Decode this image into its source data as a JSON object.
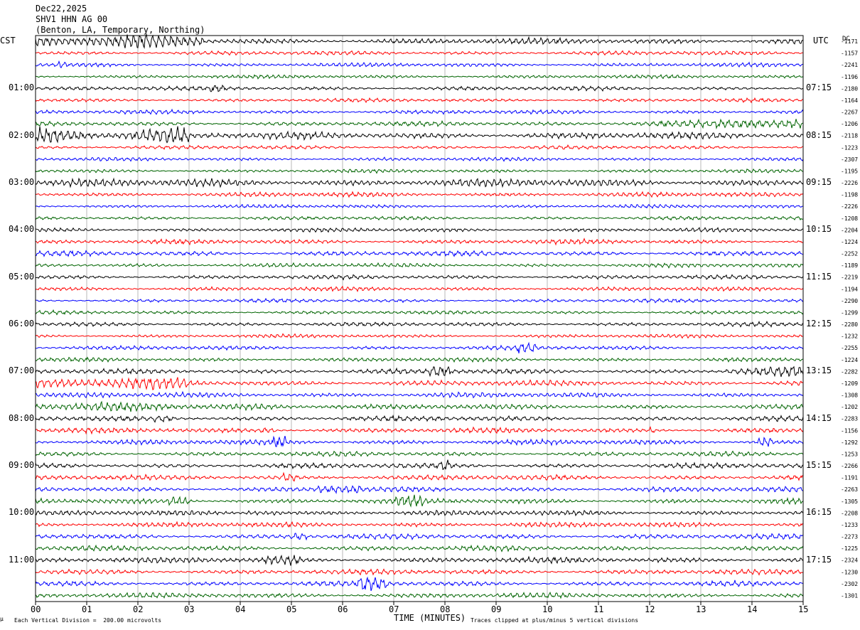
{
  "header": {
    "date": "Dec22,2025",
    "channel": "SHV1 HHN AG 00",
    "location": "(Benton, LA, Temporary, Northing)"
  },
  "left_zone": "CST",
  "right_zone": "UTC",
  "dc_label": "DC",
  "footer": {
    "division": "Each Vertical Division =  200.00 microvolts",
    "xlabel": "TIME (MINUTES)",
    "clip_note": "Traces clipped at plus/minus 5 vertical divisions",
    "corner_mark": "µ"
  },
  "colors": {
    "trace_cycle": [
      "#000000",
      "#ff0000",
      "#0000ff",
      "#006400"
    ],
    "grid": "#888888",
    "frame": "#000000"
  },
  "chart_data": {
    "type": "line",
    "title": "SHV1 HHN AG 00",
    "xlabel": "TIME (MINUTES)",
    "ylabel": "",
    "xlim": [
      0,
      15
    ],
    "x_ticks": [
      "00",
      "01",
      "02",
      "03",
      "04",
      "05",
      "06",
      "07",
      "08",
      "09",
      "10",
      "11",
      "12",
      "13",
      "14",
      "15"
    ],
    "rows_per_hour": 4,
    "left_hour_labels": [
      "01:00",
      "02:00",
      "03:00",
      "04:00",
      "05:00",
      "06:00",
      "07:00",
      "08:00",
      "09:00",
      "10:00",
      "11:00"
    ],
    "right_hour_labels": [
      "07:15",
      "08:15",
      "09:15",
      "10:15",
      "11:15",
      "12:15",
      "13:15",
      "14:15",
      "15:15",
      "16:15",
      "17:15"
    ],
    "dc_offsets": [
      "-1171",
      "-1157",
      "-2241",
      "-1196",
      "-2180",
      "-1164",
      "-2267",
      "-1206",
      "-2118",
      "-1223",
      "-2307",
      "-1195",
      "-2226",
      "-1198",
      "-2226",
      "-1208",
      "-2204",
      "-1224",
      "-2252",
      "-1189",
      "-2219",
      "-1194",
      "-2290",
      "-1299",
      "-2280",
      "-1232",
      "-2255",
      "-1224",
      "-2282",
      "-1209",
      "-1308",
      "-1202",
      "-2283",
      "-1156",
      "-1292",
      "-1253",
      "-2266",
      "-1191",
      "-2263",
      "-1305",
      "-2208",
      "-1233",
      "-2273",
      "-1225",
      "-2324",
      "-1230",
      "-2302",
      "-1301"
    ],
    "series": [
      {
        "trace_color": "black",
        "rows": [
          0,
          4,
          8,
          12,
          16,
          20,
          24,
          28,
          32,
          36,
          40,
          44
        ]
      },
      {
        "trace_color": "red",
        "rows": [
          1,
          5,
          9,
          13,
          17,
          21,
          25,
          29,
          33,
          37,
          41,
          45
        ]
      },
      {
        "trace_color": "blue",
        "rows": [
          2,
          6,
          10,
          14,
          18,
          22,
          26,
          30,
          34,
          38,
          42,
          46
        ]
      },
      {
        "trace_color": "green",
        "rows": [
          3,
          7,
          11,
          15,
          19,
          23,
          27,
          31,
          35,
          39,
          43,
          47
        ]
      }
    ],
    "amplitude": [
      1.2,
      0.8,
      0.8,
      0.7,
      0.8,
      0.7,
      0.8,
      0.9,
      1.3,
      0.7,
      0.7,
      0.7,
      1.0,
      0.9,
      0.7,
      0.7,
      0.8,
      0.9,
      1.0,
      0.8,
      0.8,
      0.8,
      0.7,
      0.7,
      0.8,
      0.7,
      0.8,
      0.8,
      1.0,
      1.1,
      1.0,
      1.0,
      1.0,
      1.0,
      1.0,
      0.9,
      1.0,
      1.0,
      1.0,
      1.0,
      1.0,
      1.0,
      1.0,
      1.0,
      1.1,
      1.0,
      1.0,
      1.0
    ],
    "bursts": [
      {
        "row": 0,
        "start_min": 0,
        "end_min": 3.3,
        "gain": 2.2
      },
      {
        "row": 2,
        "start_min": 0.4,
        "end_min": 0.6,
        "gain": 2.2
      },
      {
        "row": 4,
        "start_min": 3.4,
        "end_min": 3.7,
        "gain": 2.0
      },
      {
        "row": 7,
        "start_min": 11,
        "end_min": 15,
        "gain": 1.8
      },
      {
        "row": 7,
        "start_min": 13.3,
        "end_min": 14.2,
        "gain": 2.8
      },
      {
        "row": 8,
        "start_min": 0,
        "end_min": 3.0,
        "gain": 3.0
      },
      {
        "row": 12,
        "start_min": 0,
        "end_min": 15,
        "gain": 1.5
      },
      {
        "row": 26,
        "start_min": 9.4,
        "end_min": 9.8,
        "gain": 2.5
      },
      {
        "row": 28,
        "start_min": 7.7,
        "end_min": 8.1,
        "gain": 3.0
      },
      {
        "row": 28,
        "start_min": 13.5,
        "end_min": 15,
        "gain": 2.0
      },
      {
        "row": 29,
        "start_min": 0,
        "end_min": 3.0,
        "gain": 2.0
      },
      {
        "row": 31,
        "start_min": 0,
        "end_min": 6.0,
        "gain": 1.7
      },
      {
        "row": 32,
        "start_min": 2.3,
        "end_min": 2.7,
        "gain": 2.0
      },
      {
        "row": 33,
        "start_min": 4.4,
        "end_min": 4.7,
        "gain": 2.5
      },
      {
        "row": 33,
        "start_min": 12.0,
        "end_min": 12.1,
        "gain": 2.5
      },
      {
        "row": 34,
        "start_min": 4.6,
        "end_min": 4.9,
        "gain": 3.0
      },
      {
        "row": 34,
        "start_min": 14.1,
        "end_min": 14.4,
        "gain": 3.5
      },
      {
        "row": 36,
        "start_min": 7.9,
        "end_min": 8.1,
        "gain": 2.5
      },
      {
        "row": 37,
        "start_min": 4.8,
        "end_min": 5.1,
        "gain": 2.5
      },
      {
        "row": 38,
        "start_min": 5.5,
        "end_min": 6.4,
        "gain": 2.2
      },
      {
        "row": 39,
        "start_min": 2.6,
        "end_min": 3.0,
        "gain": 3.0
      },
      {
        "row": 39,
        "start_min": 7.0,
        "end_min": 7.6,
        "gain": 2.0
      },
      {
        "row": 40,
        "start_min": 4.1,
        "end_min": 4.8,
        "gain": 2.0
      },
      {
        "row": 42,
        "start_min": 5.0,
        "end_min": 5.3,
        "gain": 2.5
      },
      {
        "row": 44,
        "start_min": 4.5,
        "end_min": 5.2,
        "gain": 2.0
      },
      {
        "row": 46,
        "start_min": 6.3,
        "end_min": 6.9,
        "gain": 3.0
      }
    ],
    "grid": true,
    "legend": "none"
  }
}
